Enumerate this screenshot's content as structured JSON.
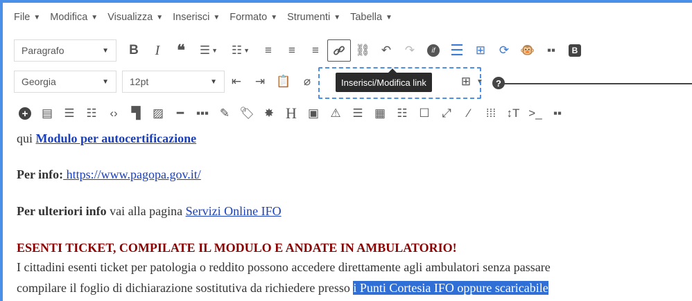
{
  "menubar": [
    {
      "label": "File",
      "key": "file"
    },
    {
      "label": "Modifica",
      "key": "modifica"
    },
    {
      "label": "Visualizza",
      "key": "visualizza"
    },
    {
      "label": "Inserisci",
      "key": "inserisci"
    },
    {
      "label": "Formato",
      "key": "formato"
    },
    {
      "label": "Strumenti",
      "key": "strumenti"
    },
    {
      "label": "Tabella",
      "key": "tabella"
    }
  ],
  "toolbar": {
    "format_select": "Paragrafo",
    "font_select": "Georgia",
    "size_select": "12pt",
    "bold_label": "B",
    "italic_label": "I",
    "blockquote_label": "❝",
    "heading_label": "H",
    "block_icon_label": "B",
    "tooltip": "Inserisci/Modifica link",
    "help_label": "?"
  },
  "content": {
    "line1_prefix": "qui ",
    "line1_link": "Modulo per autocertificazione",
    "line2_label": "Per info:",
    "line2_link": " https://www.pagopa.gov.it/",
    "line3_label": "Per ulteriori info",
    "line3_text": " vai alla pagina ",
    "line3_link": "Servizi Online IFO",
    "heading": "ESENTI TICKET, COMPILATE IL MODULO E ANDATE IN AMBULATORIO!",
    "para1": "I cittadini esenti ticket per patologia o reddito possono accedere direttamente agli ambulatori senza passare",
    "para2_text": "compilare il foglio di dichiarazione sostitutiva da richiedere presso ",
    "para2_selected": "i Punti Cortesia IFO oppure scaricabile"
  },
  "colors": {
    "accent_blue": "#4a8fe8",
    "link": "#1a3fbd",
    "heading_red": "#8b0000",
    "selection": "#2f6fd6"
  }
}
